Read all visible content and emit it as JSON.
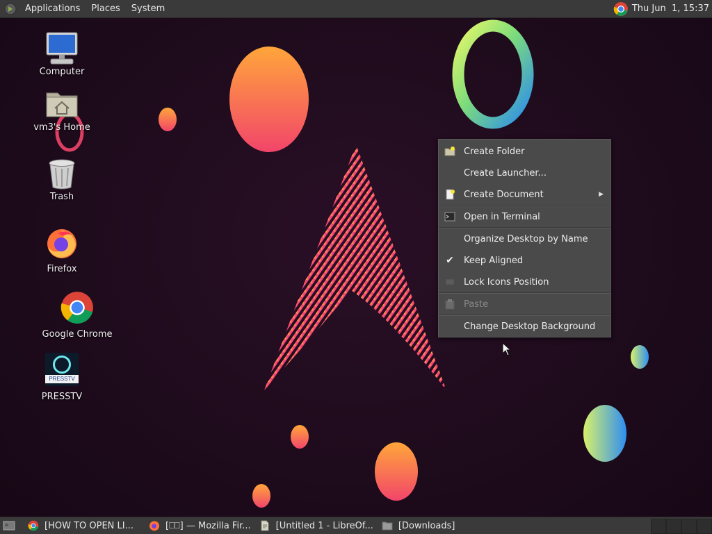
{
  "top_panel": {
    "menus": [
      "Applications",
      "Places",
      "System"
    ],
    "clock": "Thu Jun  1, 15:37",
    "tray_icon": "chrome-icon"
  },
  "desktop_icons": [
    {
      "label": "Computer",
      "icon": "computer-icon"
    },
    {
      "label": "vm3's Home",
      "icon": "home-folder-icon"
    },
    {
      "label": "Trash",
      "icon": "trash-icon"
    },
    {
      "label": "Firefox",
      "icon": "firefox-icon"
    },
    {
      "label": "Google Chrome",
      "icon": "chrome-icon"
    },
    {
      "label": "PRESSTV",
      "icon": "presstv-icon",
      "logo_text": "PRESSTV"
    }
  ],
  "context_menu": {
    "items": [
      {
        "label": "Create Folder",
        "icon": "new-folder-icon"
      },
      {
        "label": "Create Launcher...",
        "icon": ""
      },
      {
        "label": "Create Document",
        "icon": "new-document-icon",
        "submenu": true
      },
      {
        "label": "Open in Terminal",
        "icon": "terminal-icon"
      },
      {
        "label": "Organize Desktop by Name",
        "icon": ""
      },
      {
        "label": "Keep Aligned",
        "icon": "checkmark-icon",
        "checked": true
      },
      {
        "label": "Lock Icons Position",
        "icon": "unchecked-box-icon"
      },
      {
        "label": "Paste",
        "icon": "paste-icon",
        "disabled": true
      },
      {
        "label": "Change Desktop Background",
        "icon": ""
      }
    ]
  },
  "taskbar": {
    "tasks": [
      {
        "label": "[HOW TO OPEN LI...",
        "icon": "chrome-icon"
      },
      {
        "label": "[⎕⎕] — Mozilla Fir...",
        "icon": "firefox-icon"
      },
      {
        "label": "[Untitled 1 - LibreOf...",
        "icon": "libreoffice-icon"
      },
      {
        "label": "[Downloads]",
        "icon": "folder-icon"
      }
    ]
  },
  "colors": {
    "panel": "#3a3a3a",
    "menu_bg": "#4a4a4a",
    "desktop_bg": "#1e0b1c",
    "accent_pink": "#e8357a",
    "accent_orange": "#ff9a3c"
  }
}
